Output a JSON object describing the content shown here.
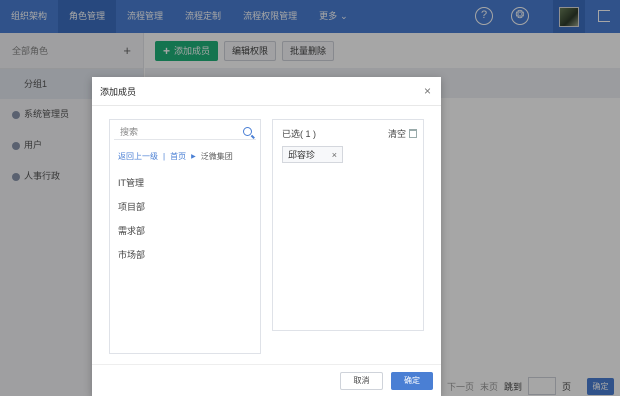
{
  "nav": {
    "items": [
      "组织架构",
      "角色管理",
      "流程管理",
      "流程定制",
      "流程权限管理"
    ],
    "active_index": 1,
    "more_label": "更多"
  },
  "icons": {
    "help": "help-circle-icon",
    "aperture": "aperture-icon",
    "logout": "logout-icon",
    "search": "search-icon",
    "trash": "trash-icon",
    "close": "close-icon",
    "user": "user-icon"
  },
  "colors": {
    "nav_bg": "#4a7fd4",
    "primary": "#4a7fd4",
    "add_button": "#1fb37a"
  },
  "sidebar": {
    "header": "全部角色",
    "add_symbol": "+",
    "group": "分组1",
    "items": [
      "系统管理员",
      "用户",
      "人事行政"
    ]
  },
  "toolbar": {
    "add_member": "添加成员",
    "edit_permission": "编辑权限",
    "batch_delete": "批量删除"
  },
  "pagination": {
    "next": "下一页",
    "last": "末页",
    "jump": "跳到",
    "page_unit": "页",
    "confirm": "确定"
  },
  "modal": {
    "title": "添加成员",
    "close_symbol": "×",
    "search_placeholder": "搜索",
    "breadcrumb": {
      "back": "返回上一级",
      "home": "首页",
      "current": "泛微集团"
    },
    "departments": [
      "IT管理",
      "项目部",
      "需求部",
      "市场部"
    ],
    "selected_title": "已选( 1 )",
    "clear_label": "清空",
    "selected_items": [
      {
        "name": "邱容珍",
        "remove": "×"
      }
    ],
    "cancel": "取消",
    "confirm": "确定"
  }
}
